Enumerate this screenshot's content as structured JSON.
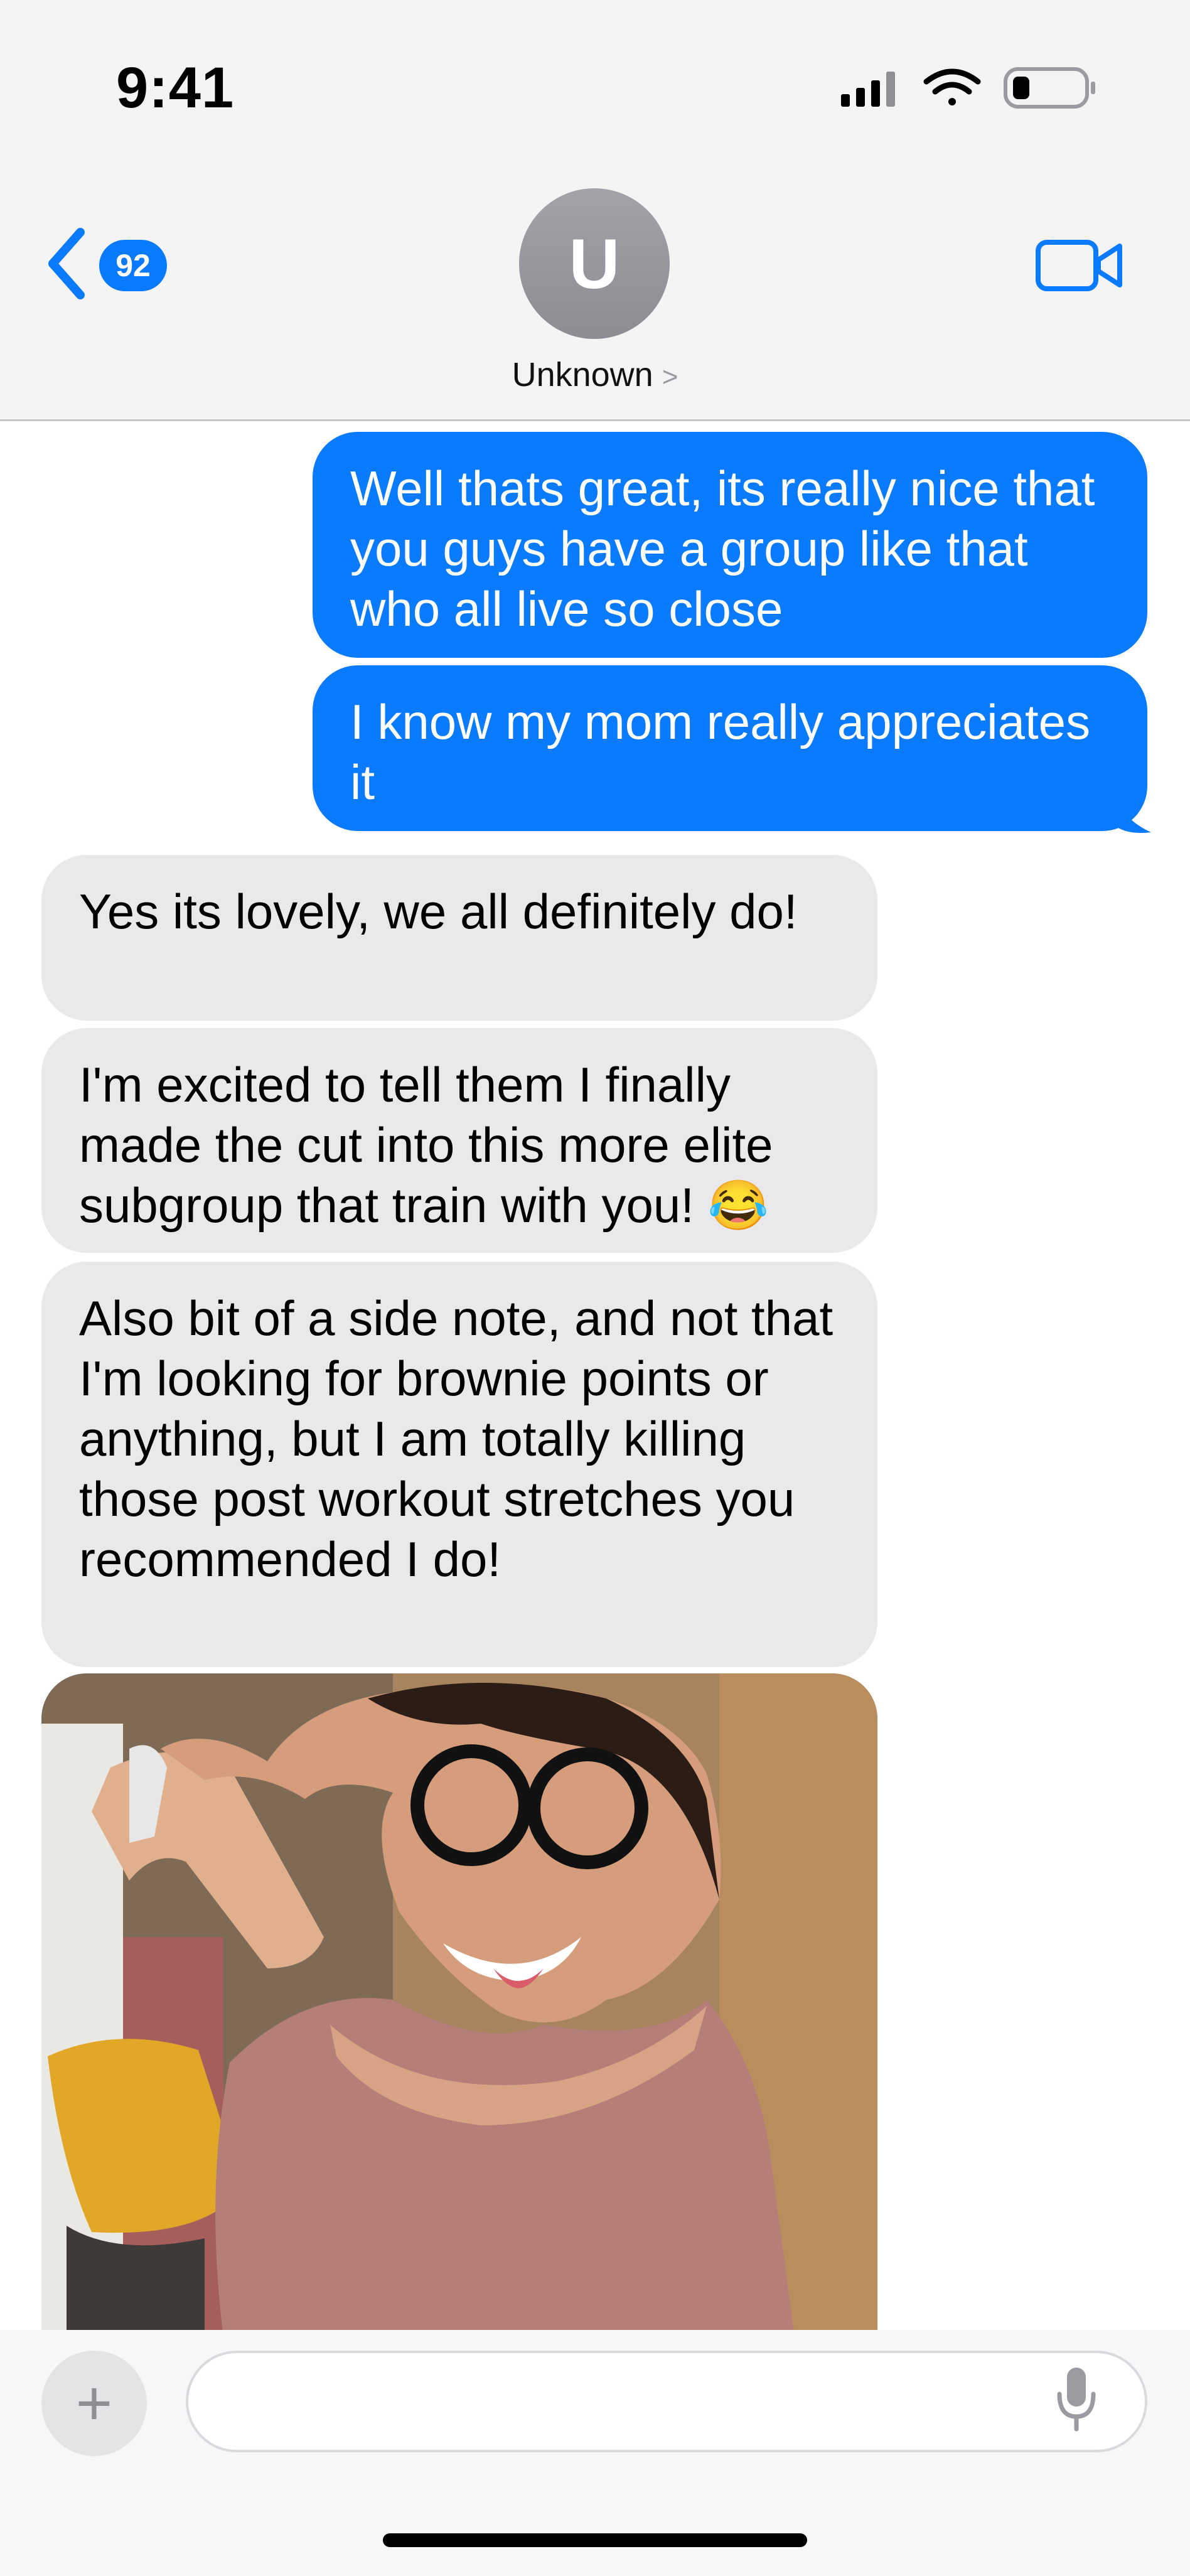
{
  "status_bar": {
    "time": "9:41"
  },
  "header": {
    "back_badge": "92",
    "avatar_initial": "U",
    "contact_name": "Unknown",
    "contact_chevron": ">"
  },
  "messages": [
    {
      "side": "outgoing",
      "text": "Well thats great, its really nice that you guys have a group like that who all live so close"
    },
    {
      "side": "outgoing",
      "text": "I know my mom really appreciates it"
    },
    {
      "side": "incoming",
      "text": "Yes its lovely, we all definitely do!"
    },
    {
      "side": "incoming",
      "text": "I'm excited to tell them I finally made the cut into this more elite subgroup that train with you! 😂"
    },
    {
      "side": "incoming",
      "text": "Also bit of a side note, and not that I'm looking for brownie points or anything, but I am totally killing those post workout stretches you recommended I do!"
    }
  ],
  "composer": {
    "plus_label": "+",
    "placeholder": ""
  },
  "colors": {
    "accent": "#0a7aff",
    "incoming_bubble": "#e9e9eb",
    "header_bg": "#f4f4f5"
  },
  "icons": [
    "cellular-signal-icon",
    "wifi-icon",
    "battery-icon",
    "back-chevron-icon",
    "video-camera-icon",
    "microphone-icon",
    "plus-icon"
  ]
}
